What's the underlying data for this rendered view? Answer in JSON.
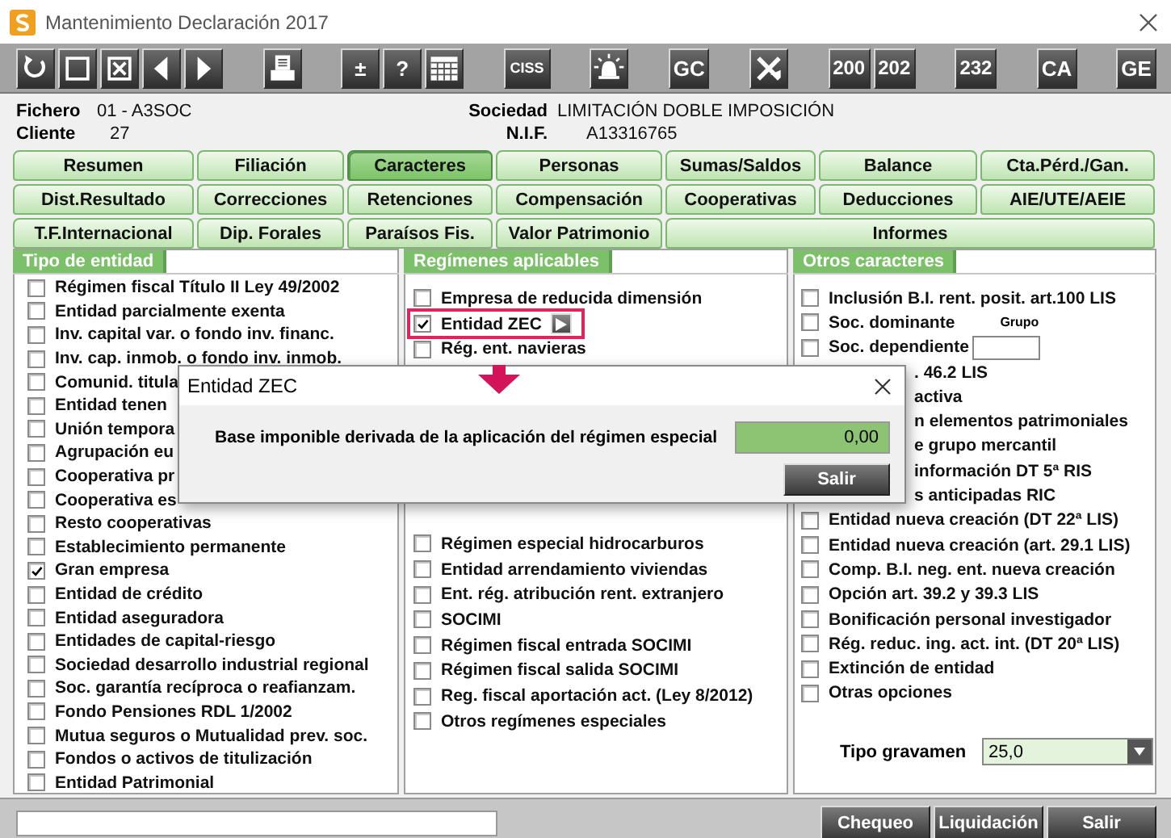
{
  "window": {
    "title": "Mantenimiento Declaración 2017"
  },
  "toolbar": [
    [
      {
        "kind": "icon"
      },
      {
        "kind": "icon"
      },
      {
        "kind": "icon"
      },
      {
        "kind": "icon"
      },
      {
        "kind": "icon"
      }
    ],
    [
      {
        "kind": "icon"
      }
    ],
    [
      {
        "kind": "text",
        "label": "±"
      },
      {
        "kind": "text",
        "label": "?"
      },
      {
        "kind": "icon"
      }
    ],
    [
      {
        "kind": "text",
        "label": "CISS"
      }
    ],
    [
      {
        "kind": "icon"
      }
    ],
    [
      {
        "kind": "text",
        "label": "GC"
      }
    ],
    [
      {
        "kind": "icon"
      }
    ],
    [
      {
        "kind": "text",
        "label": "200"
      },
      {
        "kind": "text",
        "label": "202"
      }
    ],
    [
      {
        "kind": "text",
        "label": "232"
      }
    ],
    [
      {
        "kind": "text",
        "label": "CA"
      }
    ],
    [
      {
        "kind": "text",
        "label": "GE"
      }
    ]
  ],
  "header": {
    "fields": [
      {
        "label": "Fichero",
        "value": "01 - A3SOC"
      },
      {
        "label": "Sociedad",
        "value": "LIMITACIÓN DOBLE IMPOSICIÓN"
      },
      {
        "label": "Cliente",
        "value": "27"
      },
      {
        "label": "N.I.F.",
        "value": "A13316765"
      }
    ]
  },
  "tabs": [
    [
      {
        "label": "Resumen",
        "selected": false
      },
      {
        "label": "Filiación",
        "selected": false
      },
      {
        "label": "Caracteres",
        "selected": true
      },
      {
        "label": "Personas",
        "selected": false
      },
      {
        "label": "Sumas/Saldos",
        "selected": false
      },
      {
        "label": "Balance",
        "selected": false
      },
      {
        "label": "Cta.Pérd./Gan.",
        "selected": false
      }
    ],
    [
      {
        "label": "Dist.Resultado",
        "selected": false
      },
      {
        "label": "Correcciones",
        "selected": false
      },
      {
        "label": "Retenciones",
        "selected": false
      },
      {
        "label": "Compensación",
        "selected": false
      },
      {
        "label": "Cooperativas",
        "selected": false
      },
      {
        "label": "Deducciones",
        "selected": false
      },
      {
        "label": "AIE/UTE/AEIE",
        "selected": false
      }
    ],
    [
      {
        "label": "T.F.Internacional",
        "selected": false
      },
      {
        "label": "Dip. Forales",
        "selected": false
      },
      {
        "label": "Paraísos Fis.",
        "selected": false
      },
      {
        "label": "Valor Patrimonio",
        "selected": false
      },
      {
        "label": "Informes",
        "selected": false,
        "wide": true
      }
    ]
  ],
  "entity_type": {
    "title": "Tipo de entidad",
    "items": [
      {
        "label": "Régimen fiscal Título II Ley 49/2002",
        "checked": false
      },
      {
        "label": "Entidad parcialmente exenta",
        "checked": false
      },
      {
        "label": "Inv. capital var. o fondo inv. financ.",
        "checked": false
      },
      {
        "label": "Inv. cap. inmob. o fondo inv. inmob.",
        "checked": false
      },
      {
        "label": "Comunid. titula",
        "checked": false
      },
      {
        "label": "Entidad tenen",
        "checked": false
      },
      {
        "label": "Unión tempora",
        "checked": false
      },
      {
        "label": "Agrupación eu",
        "checked": false
      },
      {
        "label": "Cooperativa pr",
        "checked": false
      },
      {
        "label": "Cooperativa es",
        "checked": false
      },
      {
        "label": "Resto cooperativas",
        "checked": false
      },
      {
        "label": "Establecimiento permanente",
        "checked": false
      },
      {
        "label": "Gran empresa",
        "checked": true
      },
      {
        "label": "Entidad de crédito",
        "checked": false
      },
      {
        "label": "Entidad aseguradora",
        "checked": false
      },
      {
        "label": "Entidades de capital-riesgo",
        "checked": false
      },
      {
        "label": "Sociedad desarrollo industrial regional",
        "checked": false
      },
      {
        "label": "Soc. garantía recíproca o reafianzam.",
        "checked": false
      },
      {
        "label": "Fondo Pensiones RDL 1/2002",
        "checked": false
      },
      {
        "label": "Mutua seguros o Mutualidad prev. soc.",
        "checked": false
      },
      {
        "label": "Fondos o activos de titulización",
        "checked": false
      },
      {
        "label": "Entidad Patrimonial",
        "checked": false
      }
    ]
  },
  "regimes": {
    "title": "Regímenes aplicables",
    "items_top": [
      {
        "label": "Empresa de reducida dimensión",
        "checked": false,
        "callout": false
      },
      {
        "label": "Entidad ZEC",
        "checked": true,
        "callout": true,
        "kind": "details"
      },
      {
        "label": "Rég. ent. navieras",
        "checked": false,
        "callout": false
      }
    ],
    "items_bottom": [
      {
        "label": "Régimen especial hidrocarburos",
        "checked": false
      },
      {
        "label": "Entidad arrendamiento viviendas",
        "checked": false
      },
      {
        "label": "Ent. rég. atribución rent. extranjero",
        "checked": false
      },
      {
        "label": "SOCIMI",
        "checked": false
      },
      {
        "label": "Régimen fiscal entrada SOCIMI",
        "checked": false
      },
      {
        "label": "Régimen fiscal salida SOCIMI",
        "checked": false
      },
      {
        "label": "Reg. fiscal aportación act. (Ley 8/2012)",
        "checked": false
      },
      {
        "label": "Otros regímenes especiales",
        "checked": false
      }
    ]
  },
  "other": {
    "title": "Otros caracteres",
    "items": [
      {
        "kind": "check",
        "label": "Inclusión B.I. rent. posit. art.100 LIS",
        "checked": false
      },
      {
        "kind": "note",
        "label": "Soc. dominante",
        "checked": false,
        "note": "Grupo"
      },
      {
        "kind": "field",
        "label": "Soc. dependiente",
        "checked": false
      },
      {
        "kind": "partial",
        "label": ". 46.2 LIS"
      },
      {
        "kind": "partial",
        "label": "activa"
      },
      {
        "kind": "partial",
        "label": "n elementos patrimoniales"
      },
      {
        "kind": "partial",
        "label": "e grupo mercantil"
      },
      {
        "kind": "partial",
        "label": "información DT 5ª RIS"
      },
      {
        "kind": "partial",
        "label": "s anticipadas RIC"
      },
      {
        "kind": "check",
        "label": "Entidad nueva creación  (DT 22ª LIS)",
        "checked": false
      },
      {
        "kind": "check",
        "label": "Entidad nueva creación (art. 29.1 LIS)",
        "checked": false
      },
      {
        "kind": "check",
        "label": "Comp. B.I. neg. ent. nueva creación",
        "checked": false
      },
      {
        "kind": "check",
        "label": "Opción art. 39.2 y 39.3 LIS",
        "checked": false
      },
      {
        "kind": "check",
        "label": "Bonificación personal investigador",
        "checked": false
      },
      {
        "kind": "check",
        "label": "Rég. reduc. ing. act. int. (DT 20ª LIS)",
        "checked": false
      },
      {
        "kind": "check",
        "label": "Extinción de entidad",
        "checked": false
      },
      {
        "kind": "check",
        "label": "Otras opciones",
        "checked": false
      }
    ],
    "rate": {
      "label": "Tipo gravamen",
      "value": "25,0"
    }
  },
  "dialog": {
    "title": "Entidad ZEC",
    "label": "Base imponible derivada de la aplicación del régimen especial",
    "value": "0,00",
    "button": "Salir"
  },
  "bottom": {
    "buttons": [
      "Chequeo",
      "Liquidación",
      "Salir"
    ]
  }
}
